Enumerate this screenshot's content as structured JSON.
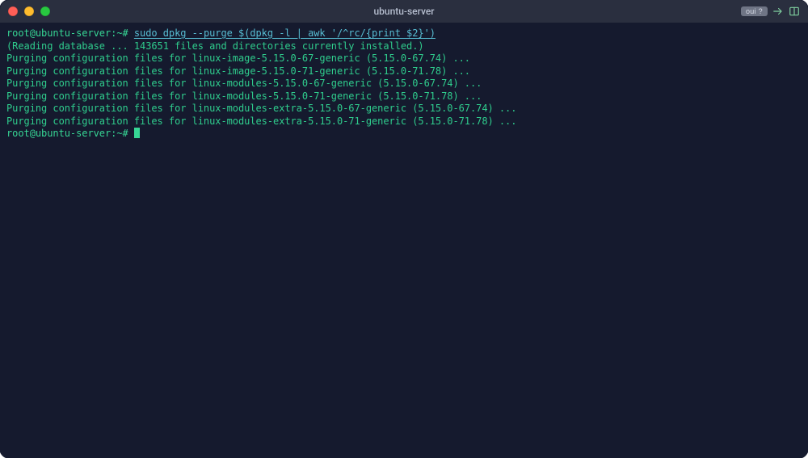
{
  "window": {
    "title": "ubuntu-server",
    "badge": "oui ?"
  },
  "terminal": {
    "prompt1": "root@ubuntu-server:~# ",
    "command": "sudo dpkg --purge $(dpkg -l | awk '/^rc/{print $2}')",
    "output": [
      "(Reading database ... 143651 files and directories currently installed.)",
      "Purging configuration files for linux-image-5.15.0-67-generic (5.15.0-67.74) ...",
      "Purging configuration files for linux-image-5.15.0-71-generic (5.15.0-71.78) ...",
      "Purging configuration files for linux-modules-5.15.0-67-generic (5.15.0-67.74) ...",
      "Purging configuration files for linux-modules-5.15.0-71-generic (5.15.0-71.78) ...",
      "Purging configuration files for linux-modules-extra-5.15.0-67-generic (5.15.0-67.74) ...",
      "Purging configuration files for linux-modules-extra-5.15.0-71-generic (5.15.0-71.78) ..."
    ],
    "prompt2": "root@ubuntu-server:~# "
  }
}
